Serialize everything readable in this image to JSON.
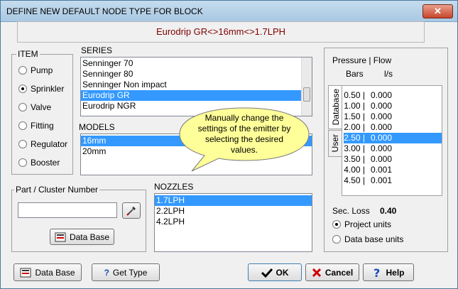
{
  "window": {
    "title": "DEFINE NEW DEFAULT NODE TYPE FOR BLOCK",
    "close_glyph": "✕"
  },
  "header": {
    "text": "Eurodrip GR<>16mm<>1.7LPH"
  },
  "item_group": {
    "label": "ITEM",
    "options": [
      "Pump",
      "Sprinkler",
      "Valve",
      "Fitting",
      "Regulator",
      "Booster"
    ],
    "selected": "Sprinkler"
  },
  "series": {
    "label": "SERIES",
    "items": [
      "Senninger 70",
      "Senninger 80",
      "Senninger Non impact",
      "Eurodrip GR",
      "Eurodrip NGR"
    ],
    "selected": "Eurodrip GR"
  },
  "models": {
    "label": "MODELS",
    "items": [
      "16mm",
      "20mm"
    ],
    "selected": "16mm"
  },
  "callout": {
    "text": "Manually change the settings of the emitter by selecting the desired values."
  },
  "part": {
    "label": "Part / Cluster Number",
    "value": "",
    "database_button": "Data Base"
  },
  "nozzles": {
    "label": "NOZZLES",
    "items": [
      "1.7LPH",
      "2.2LPH",
      "4.2LPH"
    ],
    "selected": "1.7LPH"
  },
  "pressure_flow": {
    "title": "Pressure | Flow",
    "bars_header": "Bars",
    "flow_header": "l/s",
    "tab_database": "Database",
    "tab_user": "User",
    "rows": [
      {
        "bars": "0.50 |",
        "flow": "0.000"
      },
      {
        "bars": "1.00 |",
        "flow": "0.000"
      },
      {
        "bars": "1.50 |",
        "flow": "0.000"
      },
      {
        "bars": "2.00 |",
        "flow": "0.000"
      },
      {
        "bars": "2.50 |",
        "flow": "0.000"
      },
      {
        "bars": "3.00 |",
        "flow": "0.000"
      },
      {
        "bars": "3.50 |",
        "flow": "0.000"
      },
      {
        "bars": "4.00 |",
        "flow": "0.001"
      },
      {
        "bars": "4.50 |",
        "flow": "0.001"
      }
    ],
    "selected_index": 4,
    "sec_loss_label": "Sec. Loss",
    "sec_loss_value": "0.40",
    "units_options": [
      "Project units",
      "Data base units"
    ],
    "units_selected": "Project units"
  },
  "bottom_buttons": {
    "database": "Data Base",
    "get_type": "Get Type",
    "get_type_icon_text": "?",
    "ok": "OK",
    "cancel": "Cancel",
    "help": "Help"
  },
  "colors": {
    "selection": "#3399ff",
    "header_text": "#800000",
    "callout_fill": "#ffff99",
    "ok_check": "#000000",
    "cancel_x": "#cc0000",
    "help_q": "#1a4bb5"
  }
}
